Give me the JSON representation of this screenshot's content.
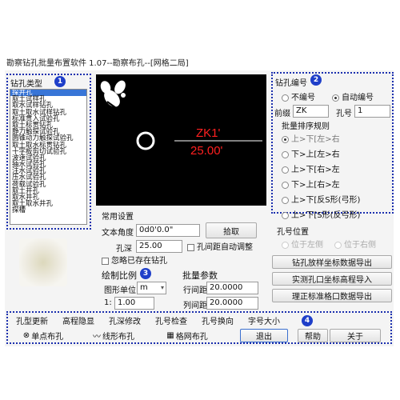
{
  "window": {
    "title": "勘察钻孔批量布置软件 1.07--勘察布孔--[网格二局]"
  },
  "badges": [
    "1",
    "2",
    "3",
    "4"
  ],
  "hole_type": {
    "label": "钻孔类型",
    "items": [
      "探井孔",
      "取土试样孔",
      "取水试样钻孔",
      "取土取水试样钻孔",
      "标准贯入试验孔",
      "取土标贯钻孔",
      "静力触探试验孔",
      "圆锥动力触探试验孔",
      "取土取水标贯钻孔",
      "十字板剪切试验孔",
      "波速试验孔",
      "抽水试验孔",
      "注水试验孔",
      "压水试验孔",
      "荷载试验孔",
      "取土井孔",
      "取水井孔",
      "取土取水井孔",
      "探槽"
    ],
    "selected_index": 0
  },
  "common": {
    "label": "常用设置",
    "text_angle_label": "文本角度",
    "text_angle_value": "0d0'0.0\"",
    "pick_button": "拾取",
    "hole_depth_label": "孔深",
    "hole_depth_value": "25.00",
    "auto_adjust_label": "孔间距自动调整",
    "ignore_existing_label": "忽略已存在钻孔"
  },
  "drawing_scale": {
    "label": "绘制比例",
    "unit_label": "图形单位:",
    "unit_value": "m",
    "ratio_prefix": "1:",
    "ratio_value": "1.00"
  },
  "batch": {
    "label": "批量参数",
    "row_spacing_label": "行间距",
    "row_spacing_value": "20.0000",
    "col_spacing_label": "列间距",
    "col_spacing_value": "20.0000"
  },
  "numbering": {
    "label": "钻孔编号",
    "no_number": "不编号",
    "auto_number": "自动编号",
    "prefix_label": "前缀",
    "prefix_value": "ZK",
    "hole_no_label": "孔号",
    "hole_no_value": "1",
    "sort_label": "批量排序规则",
    "sort_options": [
      "上>下[左>右",
      "下>上[左>右",
      "上>下[右>左",
      "下>上[右>左",
      "上>下[反S形(弓形)",
      "上>下[S形(反弓形)"
    ],
    "sort_selected": 0
  },
  "position": {
    "label": "孔号位置",
    "left": "位于左侧",
    "right": "位于右侧"
  },
  "export_buttons": [
    "钻孔放样坐标数据导出",
    "实测孔口坐标高程导入",
    "理正标准格口数据导出"
  ],
  "preview": {
    "label_main": "ZK1'",
    "label_sub": "25.00'",
    "color_label": "#ff2020",
    "color_circle": "#ffffff"
  },
  "toolbar_row1": [
    "孔型更新",
    "高程隐显",
    "孔深修改",
    "孔号检查",
    "孔号换向",
    "字号大小"
  ],
  "toolbar_row2": [
    "单点布孔",
    "线形布孔",
    "格网布孔",
    "退出",
    "帮助",
    "关于"
  ]
}
